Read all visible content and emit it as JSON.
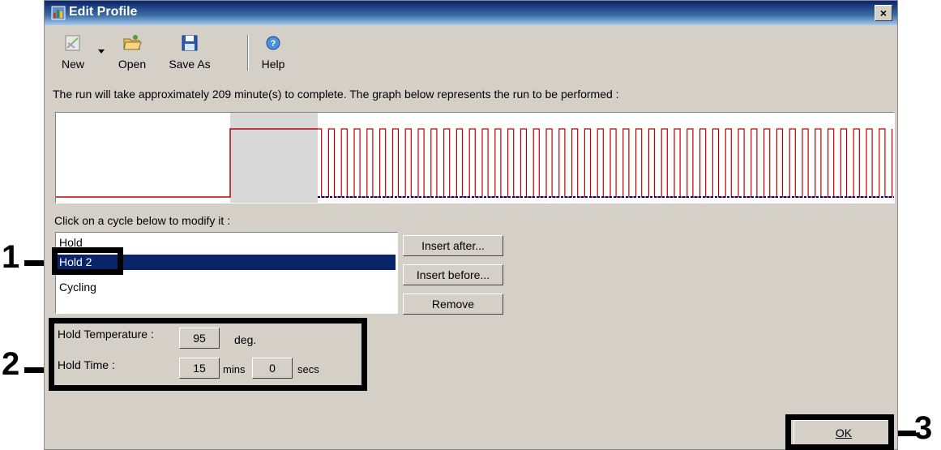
{
  "window": {
    "title": "Edit Profile",
    "close_label": "×"
  },
  "toolbar": {
    "new": "New",
    "open": "Open",
    "save_as": "Save As",
    "help": "Help"
  },
  "run_info": "The run will take approximately 209 minute(s) to complete. The graph below represents the run to be performed :",
  "cycle_prompt": "Click on a cycle below to modify it :",
  "cycles": [
    {
      "label": "Hold",
      "selected": false
    },
    {
      "label": "Hold 2",
      "selected": true
    },
    {
      "label": "Cycling",
      "selected": false
    }
  ],
  "buttons": {
    "insert_after": "Insert after...",
    "insert_before": "Insert before...",
    "remove": "Remove",
    "ok": "OK"
  },
  "hold": {
    "temperature_label": "Hold Temperature :",
    "temperature_value": "95",
    "temperature_unit": "deg.",
    "time_label": "Hold Time :",
    "minutes_value": "15",
    "minutes_unit": "mins",
    "seconds_value": "0",
    "seconds_unit": "secs"
  },
  "callouts": {
    "one": "1",
    "two": "2",
    "three": "3"
  },
  "graph": {
    "line_color": "#c00000",
    "low_color": "#000080",
    "highlight_color": "#d8d8d8",
    "cycle_count": 45
  }
}
